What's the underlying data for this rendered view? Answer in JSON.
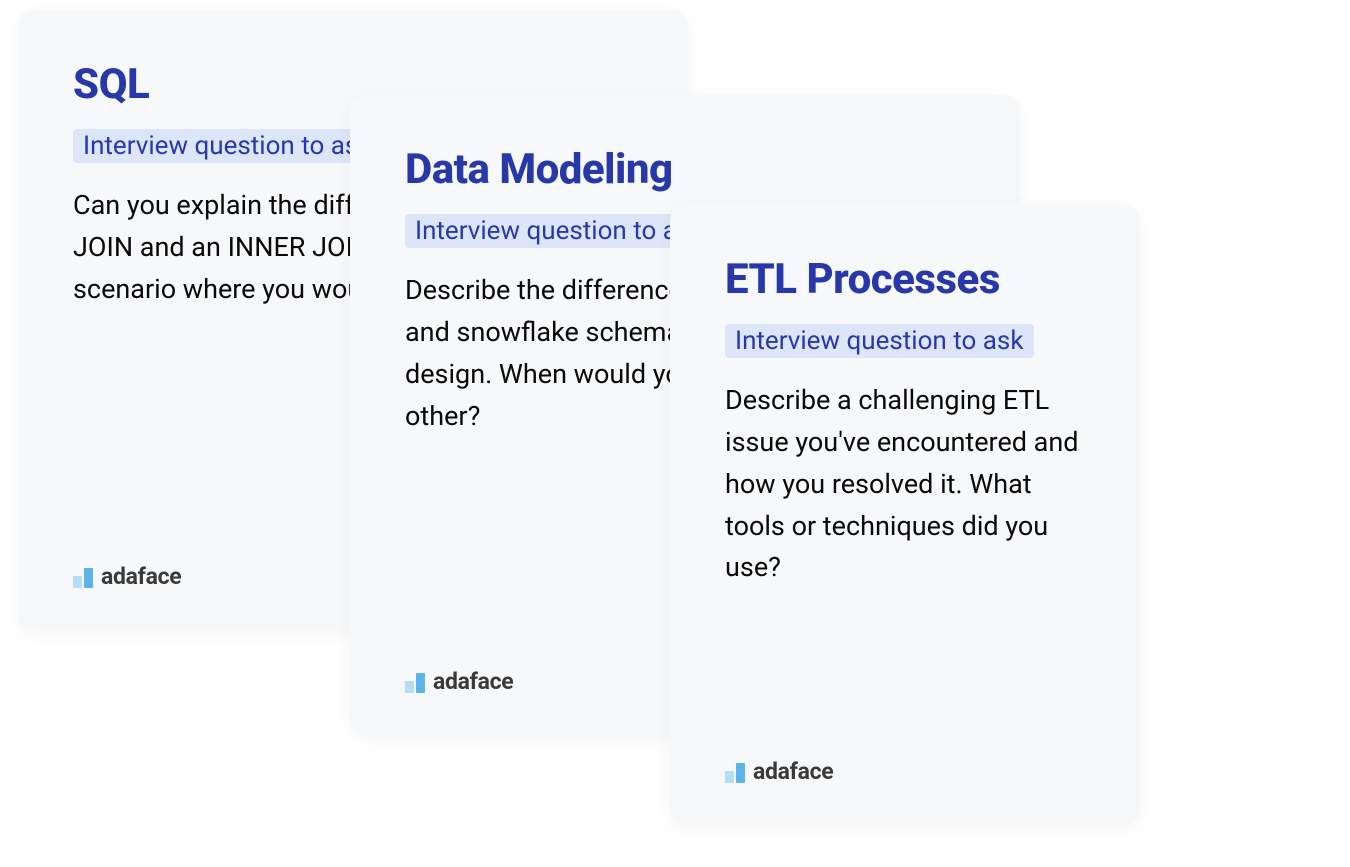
{
  "cards": [
    {
      "title": "SQL",
      "subtitle": "Interview question to ask",
      "body": "Can you explain the difference between a LEFT JOIN and an INNER JOIN, and provide a scenario where you would use each?",
      "brand": "adaface"
    },
    {
      "title": "Data Modeling",
      "subtitle": "Interview question to ask",
      "body": "Describe the difference between star schema and snowflake schema in data warehouse design. When would you use one over the other?",
      "brand": "adaface"
    },
    {
      "title": "ETL Processes",
      "subtitle": "Interview question to ask",
      "body": "Describe a challenging ETL issue you've encountered and how you resolved it. What tools or techniques did you use?",
      "brand": "adaface"
    }
  ]
}
